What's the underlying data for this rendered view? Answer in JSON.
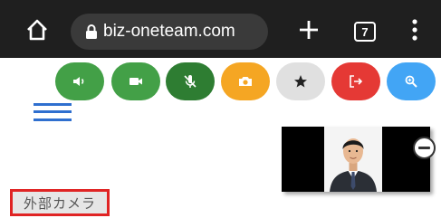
{
  "browser": {
    "url": "biz-oneteam.com",
    "tab_count": "7"
  },
  "controls": [
    {
      "name": "speaker",
      "color": "#43a047"
    },
    {
      "name": "video-camera",
      "color": "#43a047"
    },
    {
      "name": "microphone-muted",
      "color": "#2e7d32"
    },
    {
      "name": "camera-snapshot",
      "color": "#f5a623"
    },
    {
      "name": "star",
      "color": "#e0e0e0"
    },
    {
      "name": "exit",
      "color": "#e53935"
    },
    {
      "name": "zoom",
      "color": "#42a5f5"
    }
  ],
  "external_camera": {
    "label": "外部カメラ"
  },
  "colors": {
    "chrome_bg": "#1f1f1f",
    "hamburger": "#2f6fcf",
    "highlight_border": "#e02424"
  }
}
